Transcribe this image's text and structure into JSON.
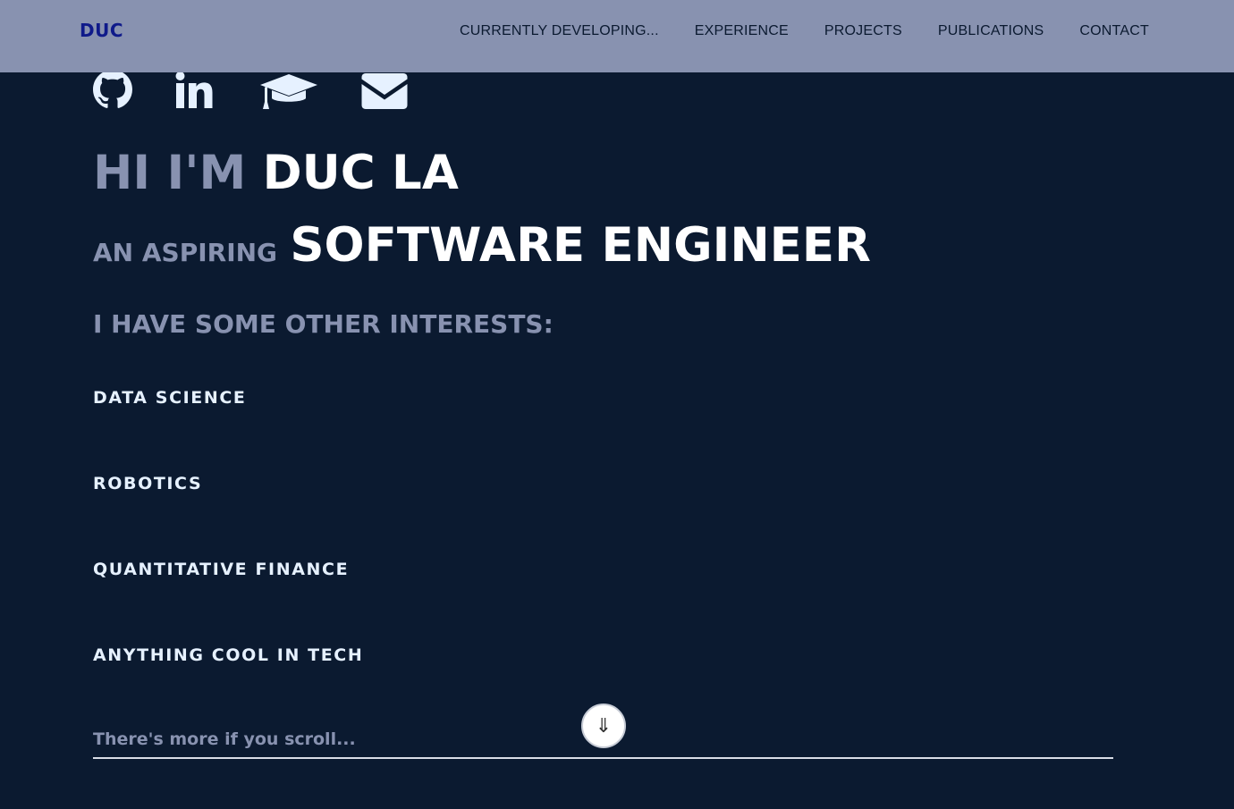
{
  "navbar": {
    "brand": "DUC",
    "links": [
      "CURRENTLY DEVELOPING...",
      "EXPERIENCE",
      "PROJECTS",
      "PUBLICATIONS",
      "CONTACT"
    ]
  },
  "socials": [
    {
      "icon": "github-icon"
    },
    {
      "icon": "linkedin-icon"
    },
    {
      "icon": "graduation-cap-icon"
    },
    {
      "icon": "email-icon"
    }
  ],
  "hero": {
    "greeting": "HI I'M",
    "name": "DUC LA",
    "role_prefix": "AN ASPIRING",
    "role": "SOFTWARE ENGINEER",
    "interests_title": "I HAVE SOME OTHER INTERESTS:",
    "interests": [
      "DATA SCIENCE",
      "ROBOTICS",
      "QUANTITATIVE FINANCE",
      "ANYTHING COOL IN TECH"
    ],
    "scroll_hint": "There's more if you scroll...",
    "scroll_button_glyph": "⇓"
  },
  "colors": {
    "background": "#0b1a30",
    "navbar": "#8892b0",
    "brand": "#0f1a8a",
    "muted": "#8892b0",
    "bright": "#ffffff",
    "interest_text": "#e6f1ff"
  }
}
